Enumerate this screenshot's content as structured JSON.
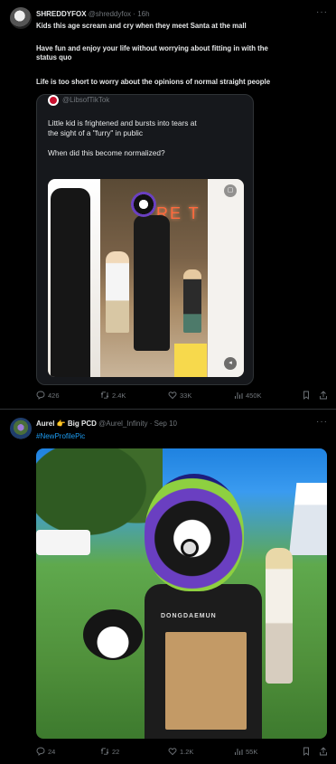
{
  "tweet1": {
    "display_name": "SHREDDYFOX",
    "handle": "@shreddyfox",
    "separator": "·",
    "time": "16h",
    "more": "···",
    "text_lines": [
      "Kids this age scream and cry when they meet Santa at the mall",
      "Have fun and enjoy your life without worrying about fitting in with the",
      "status quo",
      "Life is too short to worry about the opinions of normal straight people"
    ],
    "quote": {
      "handle": "@LibsofTikTok",
      "text_line1": "Little kid is frightened and bursts into tears at",
      "text_line2": "the sight of a \"furry\" in public",
      "text_line3": "When did this become normalized?",
      "media_sign": "RE T"
    },
    "stats": {
      "replies": "426",
      "retweets": "2.4K",
      "likes": "33K",
      "views": "450K"
    }
  },
  "tweet2": {
    "display_name": "Aurel",
    "emoji": "👉",
    "display_name2": "Big PCD",
    "handle": "@Aurel_Infinity",
    "separator": "·",
    "time": "Sep 10",
    "more": "···",
    "hashtag": "#NewProfilePic",
    "photo_shirt_text": "DONGDAEMUN",
    "stats": {
      "replies": "24",
      "retweets": "22",
      "likes": "1.2K",
      "views": "55K"
    }
  },
  "colors": {
    "background": "#000000",
    "text": "#e7e9ea",
    "muted": "#71767b",
    "link": "#1d9bf0",
    "border": "#2f3336"
  },
  "icons": [
    "reply-icon",
    "retweet-icon",
    "like-icon",
    "views-icon",
    "bookmark-icon",
    "share-icon"
  ]
}
